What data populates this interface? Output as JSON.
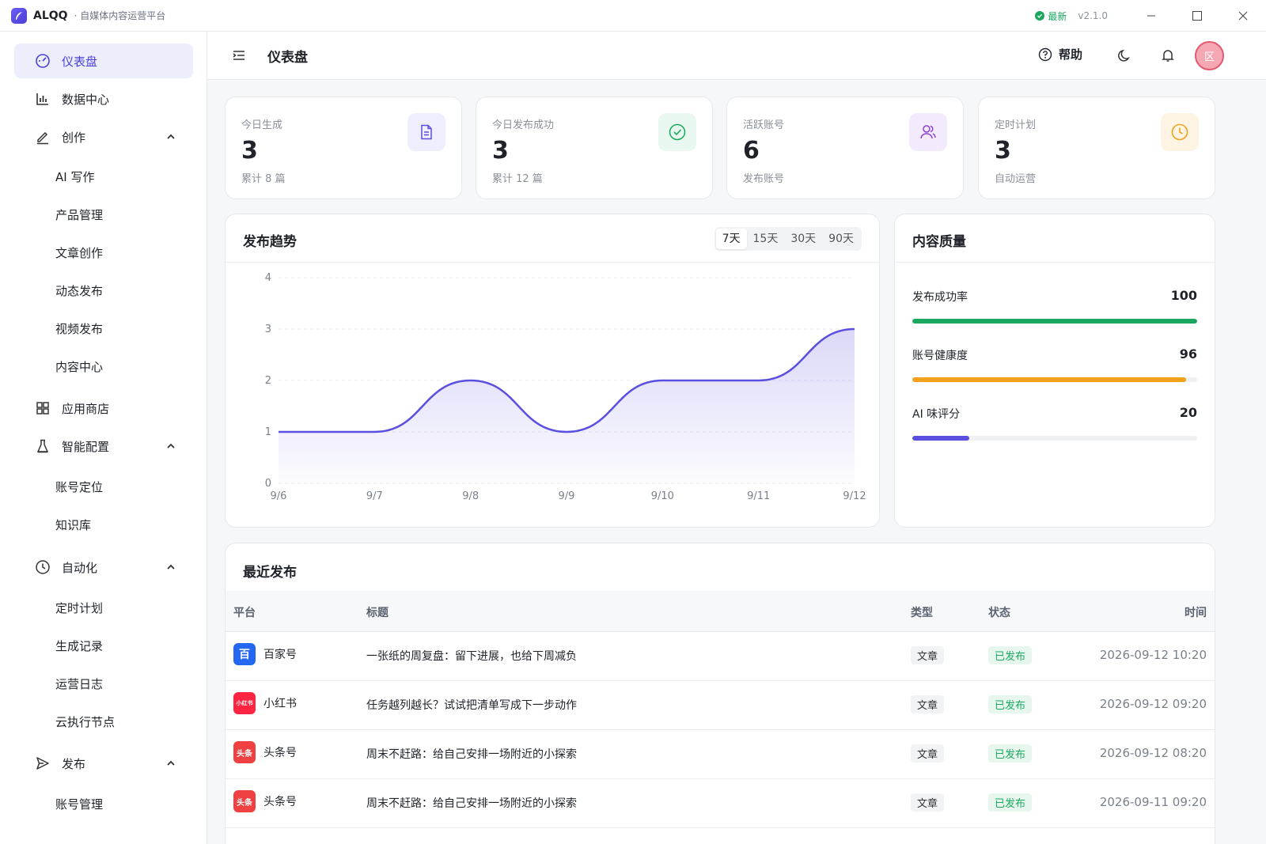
{
  "titlebar": {
    "app_name": "ALQQ",
    "app_subtitle": "· 自媒体内容运营平台",
    "latest_label": "最新",
    "version": "v2.1.0"
  },
  "sidebar": {
    "items": [
      {
        "label": "仪表盘",
        "icon": "dashboard-icon",
        "active": true
      },
      {
        "label": "数据中心",
        "icon": "bar-chart-icon"
      },
      {
        "label": "创作",
        "icon": "pen-icon",
        "expanded": true
      },
      {
        "label": "AI 写作",
        "sub": true
      },
      {
        "label": "产品管理",
        "sub": true
      },
      {
        "label": "文章创作",
        "sub": true
      },
      {
        "label": "动态发布",
        "sub": true
      },
      {
        "label": "视频发布",
        "sub": true
      },
      {
        "label": "内容中心",
        "sub": true
      },
      {
        "label": "应用商店",
        "icon": "grid-icon"
      },
      {
        "label": "智能配置",
        "icon": "flask-icon",
        "expanded": true
      },
      {
        "label": "账号定位",
        "sub": true
      },
      {
        "label": "知识库",
        "sub": true
      },
      {
        "label": "自动化",
        "icon": "clock-icon",
        "expanded": true
      },
      {
        "label": "定时计划",
        "sub": true
      },
      {
        "label": "生成记录",
        "sub": true
      },
      {
        "label": "运营日志",
        "sub": true
      },
      {
        "label": "云执行节点",
        "sub": true
      },
      {
        "label": "发布",
        "icon": "send-icon",
        "expanded": true
      },
      {
        "label": "账号管理",
        "sub": true
      }
    ]
  },
  "header": {
    "title": "仪表盘",
    "help_label": "帮助",
    "avatar_text": "区"
  },
  "stats": [
    {
      "label": "今日生成",
      "value": "3",
      "sub": "累计 8 篇",
      "icon": "document-icon",
      "color": "#5b4fe0",
      "bg": "#efeefe"
    },
    {
      "label": "今日发布成功",
      "value": "3",
      "sub": "累计 12 篇",
      "icon": "check-circle-icon",
      "color": "#1aa861",
      "bg": "#e8f7ef"
    },
    {
      "label": "活跃账号",
      "value": "6",
      "sub": "发布账号",
      "icon": "users-icon",
      "color": "#8b3fd6",
      "bg": "#f3eafd"
    },
    {
      "label": "定时计划",
      "value": "3",
      "sub": "自动运营",
      "icon": "clock-icon",
      "color": "#f0a21b",
      "bg": "#fdf4e4"
    }
  ],
  "trend": {
    "title": "发布趋势",
    "ranges": [
      "7天",
      "15天",
      "30天",
      "90天"
    ],
    "active_range": "7天"
  },
  "chart_data": {
    "type": "area",
    "x": [
      "9/6",
      "9/7",
      "9/8",
      "9/9",
      "9/10",
      "9/11",
      "9/12"
    ],
    "values": [
      1,
      1,
      2,
      1,
      2,
      2,
      3
    ],
    "ylim": [
      0,
      4
    ],
    "yticks": [
      "0",
      "1",
      "2",
      "3",
      "4"
    ],
    "grid": true,
    "color": "#5b4fe0"
  },
  "quality": {
    "title": "内容质量",
    "rows": [
      {
        "label": "发布成功率",
        "value": "100",
        "fraction": 1.0,
        "color": "#1aa861"
      },
      {
        "label": "账号健康度",
        "value": "96",
        "fraction": 0.96,
        "color": "#f0a21b"
      },
      {
        "label": "AI 味评分",
        "value": "20",
        "fraction": 0.2,
        "color": "#5b4fe0"
      }
    ]
  },
  "recent": {
    "title": "最近发布",
    "columns": {
      "platform": "平台",
      "title": "标题",
      "type": "类型",
      "status": "状态",
      "time": "时间"
    },
    "rows": [
      {
        "platform": "百家号",
        "logo": "百",
        "logo_color": "#2468f2",
        "title": "一张纸的周复盘：留下进展，也给下周减负",
        "type": "文章",
        "status": "已发布",
        "time": "2026-09-12 10:20"
      },
      {
        "platform": "小红书",
        "logo": "小红书",
        "logo_color": "#ff2442",
        "title": "任务越列越长？试试把清单写成下一步动作",
        "type": "文章",
        "status": "已发布",
        "time": "2026-09-12 09:20"
      },
      {
        "platform": "头条号",
        "logo": "头条",
        "logo_color": "#f04142",
        "title": "周末不赶路：给自己安排一场附近的小探索",
        "type": "文章",
        "status": "已发布",
        "time": "2026-09-12 08:20"
      },
      {
        "platform": "头条号",
        "logo": "头条",
        "logo_color": "#f04142",
        "title": "周末不赶路：给自己安排一场附近的小探索",
        "type": "文章",
        "status": "已发布",
        "time": "2026-09-11 09:20"
      }
    ]
  }
}
